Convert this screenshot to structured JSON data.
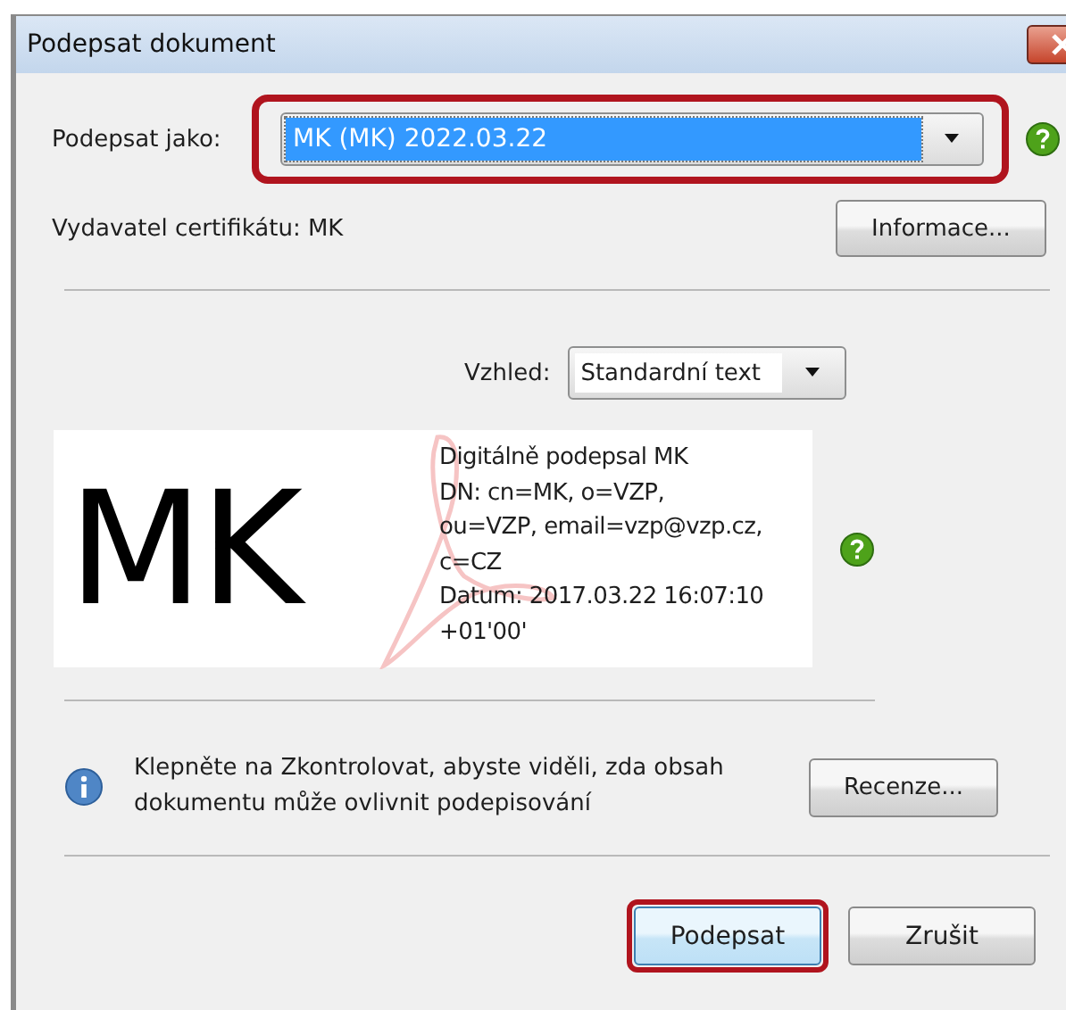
{
  "window": {
    "title": "Podepsat dokument"
  },
  "sign_as": {
    "label": "Podepsat jako:",
    "value": "MK (MK) 2022.03.22",
    "highlighted": true
  },
  "issuer": {
    "text": "Vydavatel certifikátu: MK",
    "button": "Informace..."
  },
  "appearance": {
    "label": "Vzhled:",
    "value": "Standardní text"
  },
  "preview": {
    "name": "MK",
    "lines": [
      "Digitálně podepsal MK",
      "DN: cn=MK, o=VZP,",
      "ou=VZP, email=vzp@vzp.cz,",
      "c=CZ",
      "Datum: 2017.03.22 16:07:10",
      "+01'00'"
    ]
  },
  "review": {
    "text": "Klepněte na Zkontrolovat, abyste viděli, zda obsah dokumentu může ovlivnit podepisování",
    "button": "Recenze..."
  },
  "buttons": [
    {
      "label": "Podepsat",
      "highlighted": true
    },
    {
      "label": "Zrušit",
      "highlighted": false
    }
  ]
}
